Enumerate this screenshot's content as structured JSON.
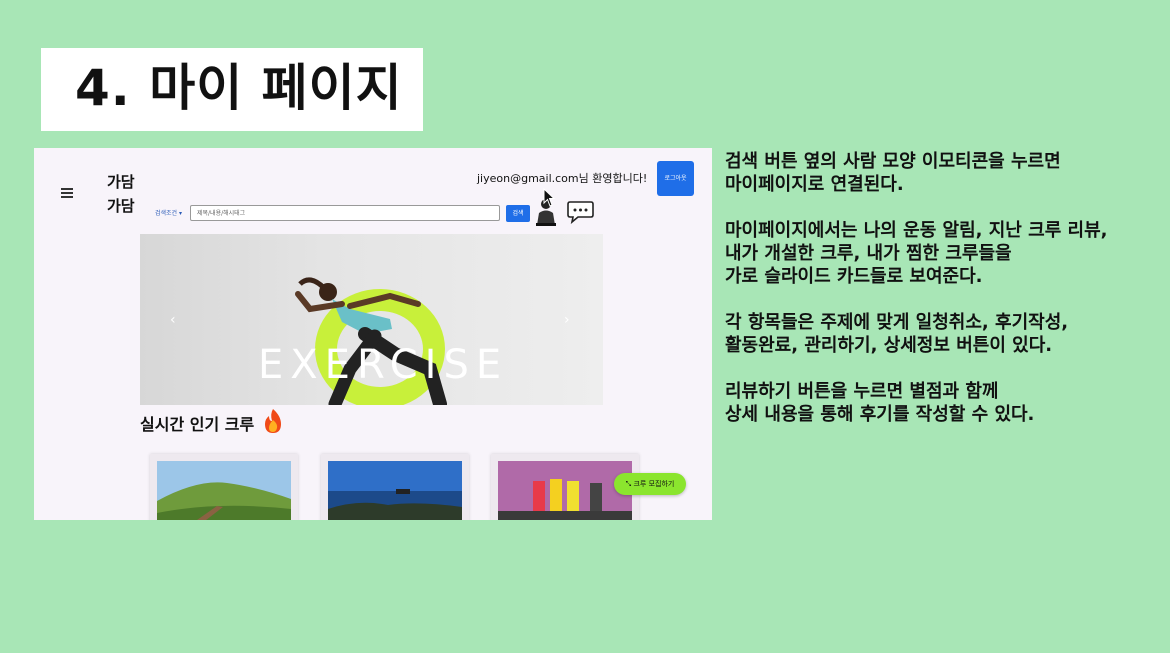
{
  "slide": {
    "title": "4. 마이 페이지"
  },
  "app": {
    "logo_line1": "가담",
    "logo_line2": "가담",
    "search_filter_label": "검색조건 ▾",
    "search_placeholder": "제목/내용/해시태그",
    "search_button": "검색",
    "welcome_text": "jiyeon@gmail.com님 환영합니다!",
    "logout_button": "로그아웃",
    "hero_text": "EXERCISE",
    "prev_arrow": "‹",
    "next_arrow": "›",
    "section_title": "실시간 인기 크루",
    "recruit_button": "크루 모집하기",
    "icons": {
      "menu": "hamburger-menu-icon",
      "person": "person-icon",
      "chat": "chat-bubble-icon",
      "cursor": "mouse-cursor-icon",
      "fire": "fire-icon",
      "expand": "expand-arrows-icon"
    }
  },
  "description": {
    "p1": [
      "검색 버튼 옆의 사람 모양 이모티콘을 누르면",
      "마이페이지로 연결된다."
    ],
    "p2": [
      "마이페이지에서는 나의 운동 알림, 지난 크루 리뷰,",
      "내가 개설한 크루, 내가 찜한 크루들을",
      "가로 슬라이드 카드들로 보여준다."
    ],
    "p3": [
      "각 항목들은 주제에 맞게 일청취소, 후기작성,",
      "활동완료, 관리하기, 상세정보 버튼이 있다."
    ],
    "p4": [
      "리뷰하기 버튼을 누르면 별점과 함께",
      "상세 내용을 통해 후기를 작성할 수 있다."
    ]
  },
  "colors": {
    "background": "#a8e6b6",
    "accent_blue": "#1f6ee8",
    "recruit_green": "#8be52e",
    "ring_lime": "#c8f03a"
  }
}
